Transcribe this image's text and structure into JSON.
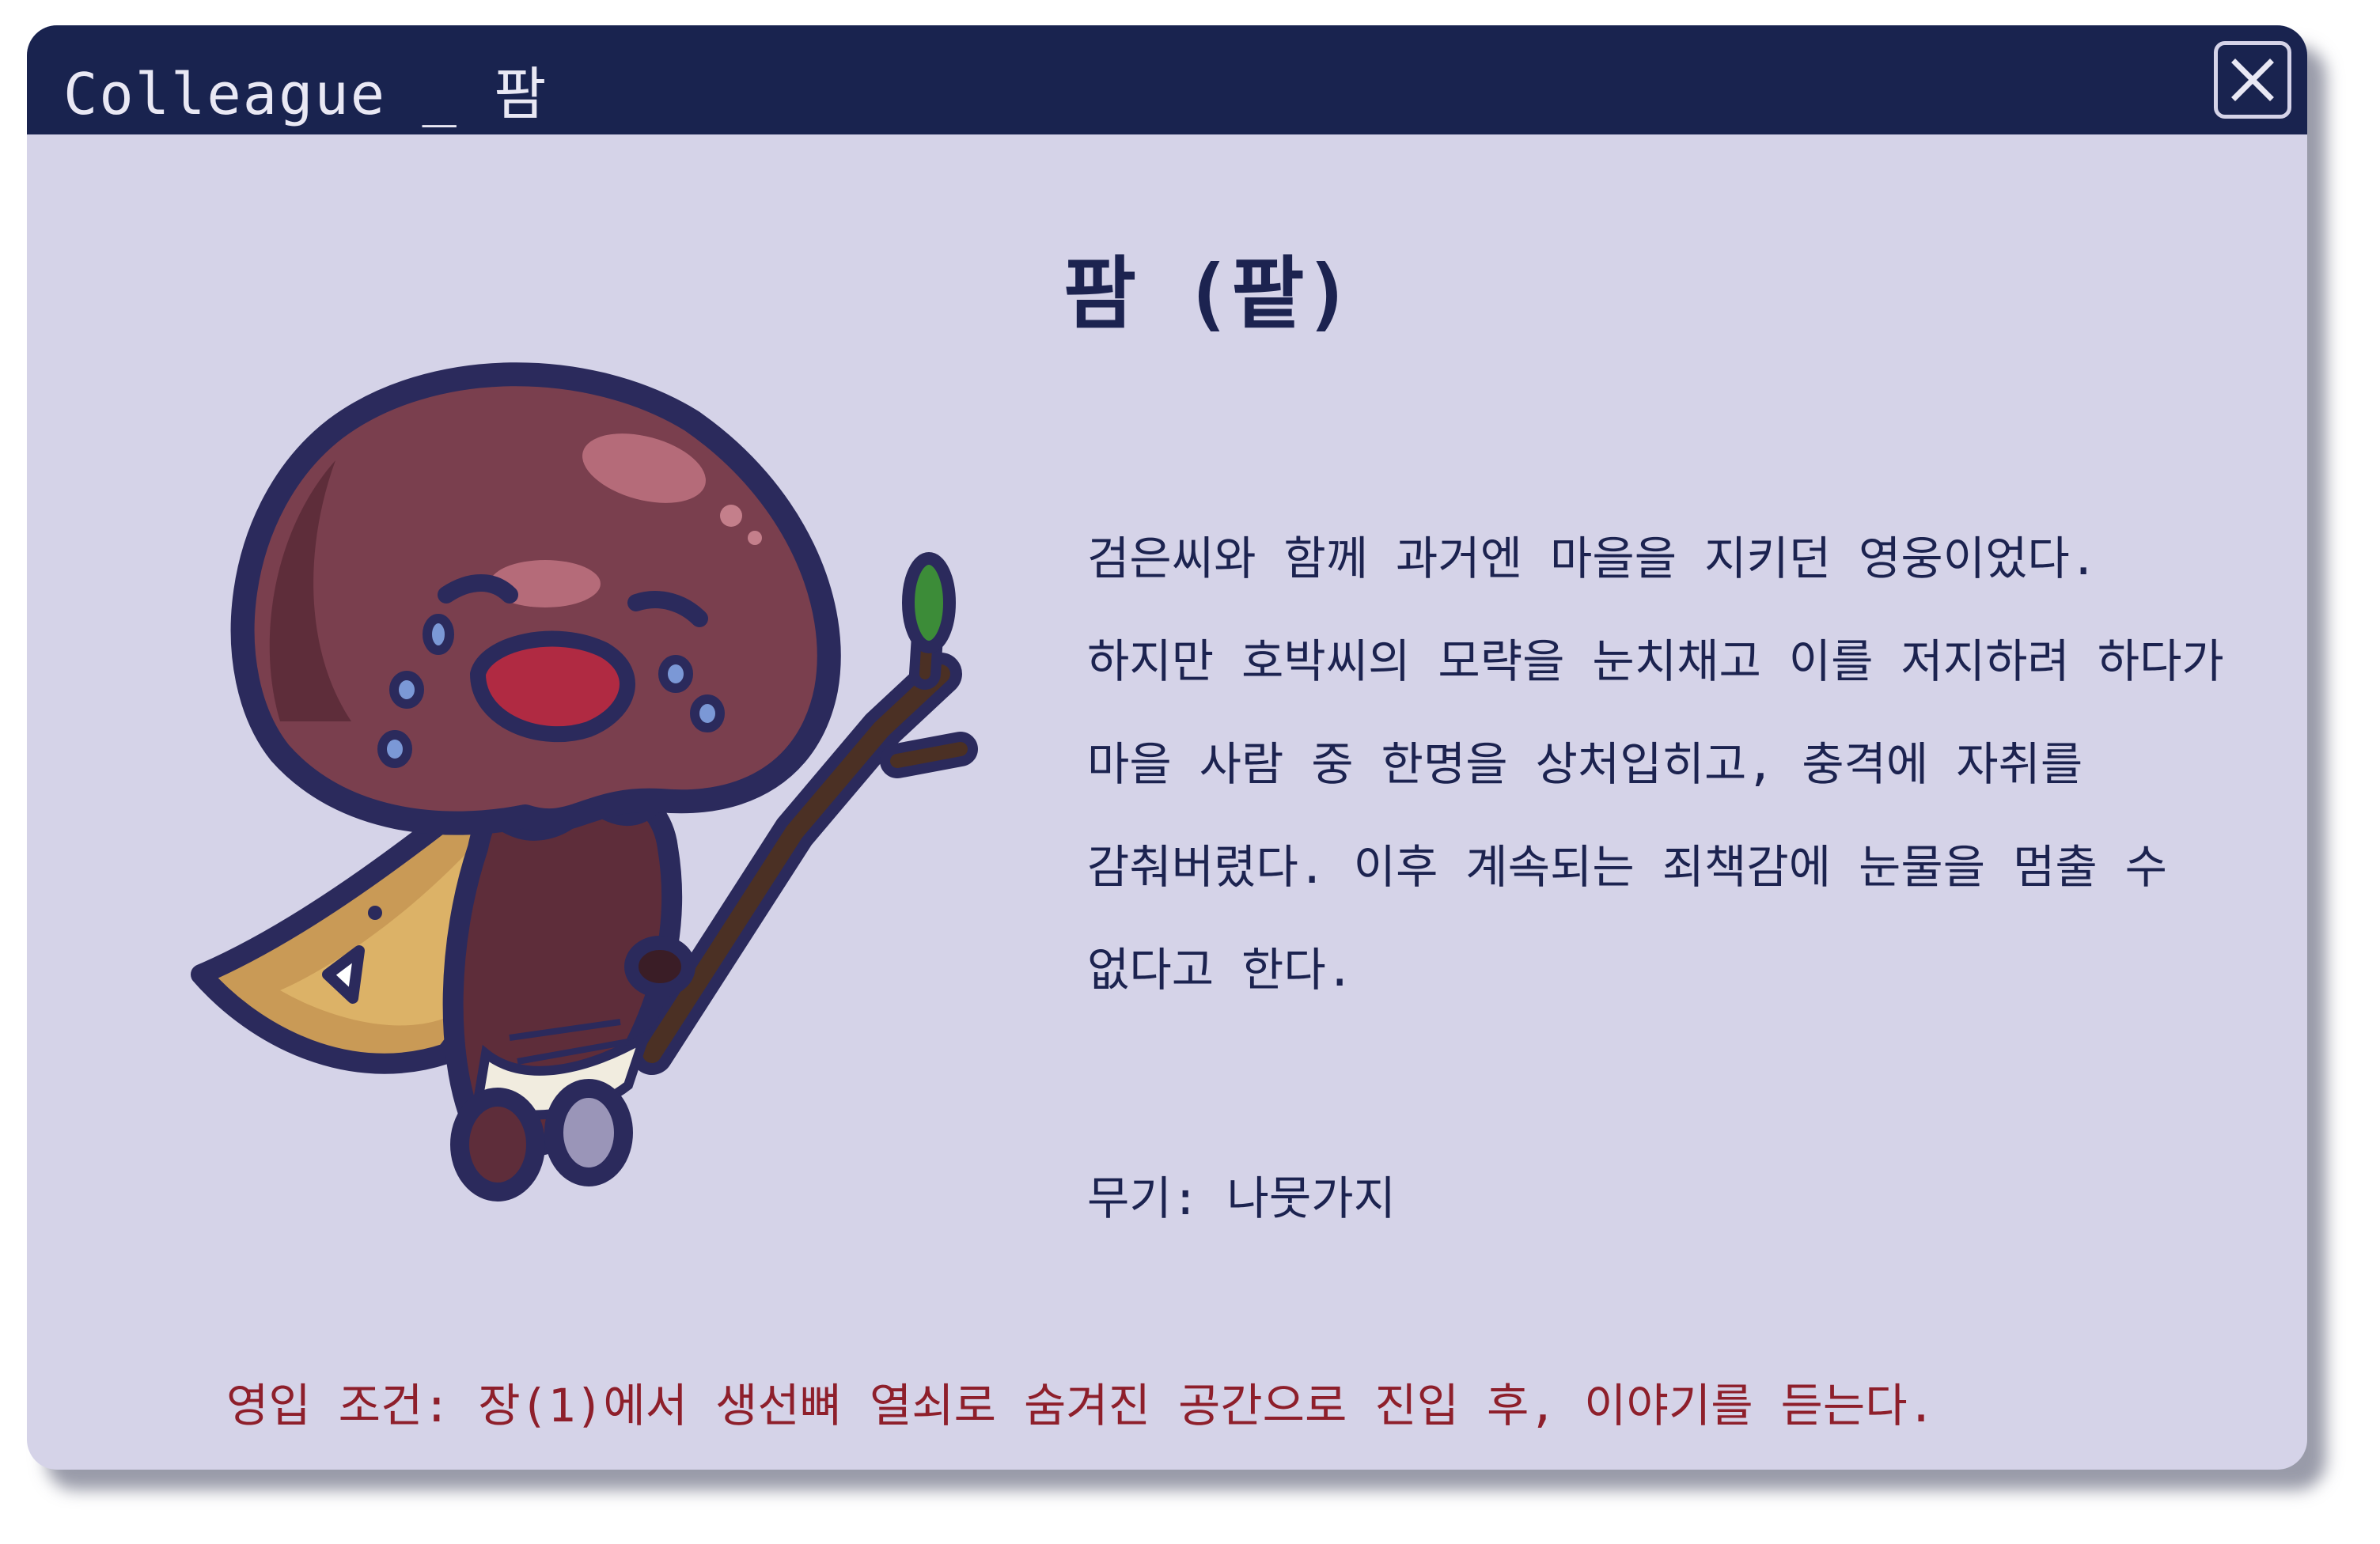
{
  "window": {
    "title": "Colleague _ 팜",
    "close_icon": "close-icon"
  },
  "character": {
    "name": "팜 (팥)",
    "portrait": "crying red-bean character with cape and twig staff",
    "description": [
      "검은씨와 함께 과거엔 마을을 지키던 영웅이었다.",
      "하지만 호박씨의 모략을 눈치채고 이를 저지하려 하다가",
      "마을 사람 중 한명을 상처입히고, 충격에 자취를",
      "감춰버렸다. 이후 계속되는 죄책감에 눈물을 멈출 수",
      "없다고 한다."
    ],
    "weapon": "무기: 나뭇가지"
  },
  "recruit_condition": "영입 조건: 장(1)에서 생선뼈 열쇠로 숨겨진 공간으로 진입 후, 이야기를 듣는다.",
  "colors": {
    "title_bar": "#19234f",
    "panel": "#d5d3e8",
    "text": "#1c2350",
    "condition_text": "#8e1f2b"
  }
}
